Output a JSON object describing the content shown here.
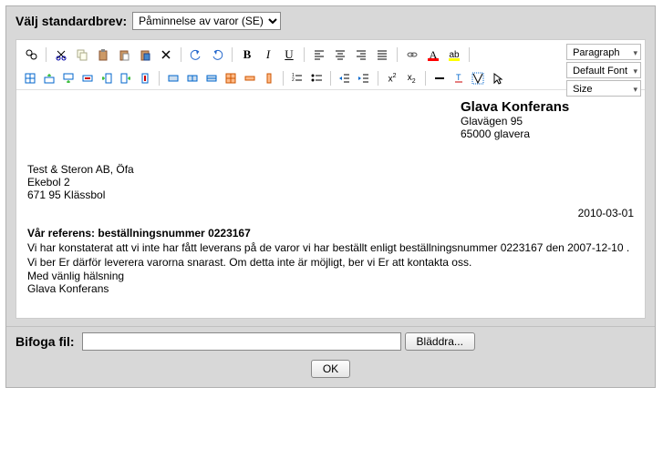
{
  "header": {
    "label": "Välj standardbrev:",
    "selected": "Påminnelse av varor (SE)"
  },
  "toolbar": {
    "paragraph": "Paragraph",
    "font": "Default Font",
    "size": "Size"
  },
  "letter": {
    "sender": {
      "name": "Glava Konferans",
      "addr1": "Glavägen 95",
      "addr2": "65000 glavera"
    },
    "recipient": {
      "line1": "Test & Steron AB, Öfa",
      "line2": "Ekebol 2",
      "line3": "671 95 Klässbol"
    },
    "date": "2010-03-01",
    "reference": "Vår referens: beställningsnummer 0223167",
    "body": "Vi har konstaterat att vi inte har fått leverans på de varor vi har beställt enligt beställningsnummer 0223167 den 2007-12-10 . Vi ber Er därför leverera varorna snarast. Om detta inte är möjligt, ber vi Er att kontakta oss.",
    "closing1": "Med vänlig hälsning",
    "closing2": "Glava Konferans"
  },
  "attach": {
    "label": "Bifoga fil:",
    "value": "",
    "browse": "Bläddra..."
  },
  "footer": {
    "ok": "OK"
  }
}
